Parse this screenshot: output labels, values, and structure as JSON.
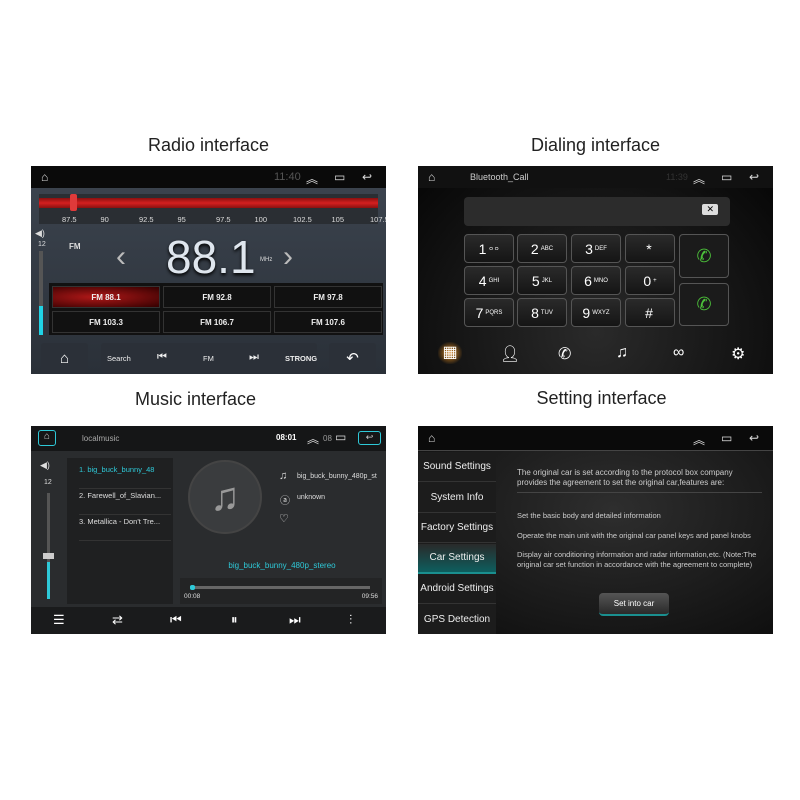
{
  "captions": {
    "radio": "Radio interface",
    "dial": "Dialing interface",
    "music": "Music interface",
    "setting": "Setting interface"
  },
  "radio": {
    "time": "11:40",
    "scale": [
      "87.5",
      "90",
      "92.5",
      "95",
      "97.5",
      "100",
      "102.5",
      "105",
      "107.5"
    ],
    "volume": "12",
    "volume_level": 0.35,
    "band": "FM",
    "frequency": "88.1",
    "unit": "MHz",
    "presets": [
      "FM 88.1",
      "FM 92.8",
      "FM 97.8",
      "FM 103.3",
      "FM 106.7",
      "FM 107.6"
    ],
    "active_preset": 0,
    "bottom": {
      "search": "Search",
      "band": "FM",
      "strong": "STRONG"
    },
    "colors": {
      "accent": "#cc1f1f",
      "volume": "#20d4e6"
    }
  },
  "dial": {
    "title": "Bluetooth_Call",
    "time": "11:39",
    "keys": [
      {
        "d": "1",
        "s": "ㅇㅇ"
      },
      {
        "d": "2",
        "s": "ABC"
      },
      {
        "d": "3",
        "s": "DEF"
      },
      {
        "d": "*",
        "s": ""
      },
      {
        "d": "4",
        "s": "GHI"
      },
      {
        "d": "5",
        "s": "JKL"
      },
      {
        "d": "6",
        "s": "MNO"
      },
      {
        "d": "0",
        "s": "+"
      },
      {
        "d": "7",
        "s": "PQRS"
      },
      {
        "d": "8",
        "s": "TUV"
      },
      {
        "d": "9",
        "s": "WXYZ"
      },
      {
        "d": "#",
        "s": ""
      }
    ],
    "colors": {
      "call": "#4cc23a",
      "active_tab": "#e08a1e"
    }
  },
  "music": {
    "title": "localmusic",
    "time": "08:01",
    "status_extra": "08",
    "volume": "12",
    "volume_level": 0.35,
    "playlist": [
      "1. big_buck_bunny_48",
      "2. Farewell_of_Slavian...",
      "3. Metallica - Don't Tre..."
    ],
    "song": "big_buck_bunny_480p_st",
    "artist": "unknown",
    "now_playing": "big_buck_bunny_480p_stereo",
    "elapsed": "00:08",
    "duration": "09:56",
    "progress": 0.013,
    "colors": {
      "accent": "#2ec9d8"
    }
  },
  "setting": {
    "menu": [
      "Sound Settings",
      "System Info",
      "Factory Settings",
      "Car Settings",
      "Android Settings",
      "GPS Detection"
    ],
    "active": 3,
    "intro": "The original car is set according to the protocol box company provides the agreement to set the original car,features are:",
    "features": [
      "Set the basic body and detailed information",
      "Operate the main unit with the original car panel keys and panel knobs",
      "Display air conditioning information and radar information,etc. (Note:The original car set function in accordance with the agreement to complete)"
    ],
    "button": "Set into car",
    "colors": {
      "accent": "#1a8f8f"
    }
  }
}
